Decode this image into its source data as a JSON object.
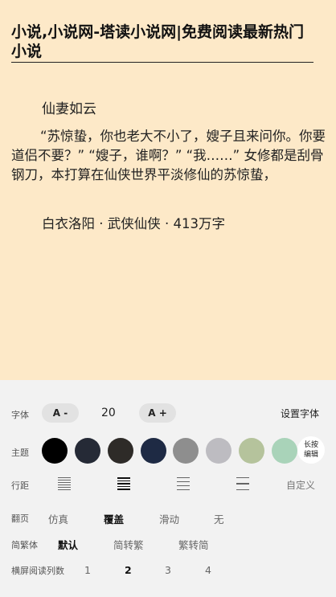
{
  "page": {
    "site_title": "小说,小说网-塔读小说网|免费阅读最新热门小说"
  },
  "book": {
    "title": "仙妻如云",
    "intro": "“苏惊蛰，你也老大不小了，嫂子且来问你。你要道侣不要？” “嫂子，谁啊？” “我……” 女修都是刮骨钢刀，本打算在仙侠世界平淡修仙的苏惊蛰，",
    "meta": "白衣洛阳 · 武侠仙侠 · 413万字"
  },
  "settings": {
    "font": {
      "label": "字体",
      "decrease": "A -",
      "size": "20",
      "increase": "A +",
      "set_font": "设置字体"
    },
    "theme": {
      "label": "主题",
      "colors": [
        "#000000",
        "#252a36",
        "#2e2b28",
        "#1e2a44",
        "#8e8e8e",
        "#bdbcc1",
        "#b5c39c",
        "#a9d3b9"
      ],
      "custom": "长按编辑"
    },
    "spacing": {
      "label": "行距",
      "options": [
        "spacing-tight-icon",
        "spacing-normal-icon",
        "spacing-loose-icon",
        "spacing-wide-icon"
      ],
      "selected": 1,
      "custom": "自定义"
    },
    "page_turn": {
      "label": "翻页",
      "options": [
        "仿真",
        "覆盖",
        "滑动",
        "无"
      ],
      "selected": 1
    },
    "script": {
      "label": "简繁体",
      "options": [
        "默认",
        "简转繁",
        "繁转简"
      ],
      "selected": 0
    },
    "columns": {
      "label": "横屏阅读列数",
      "options": [
        "1",
        "2",
        "3",
        "4"
      ],
      "selected": 1
    }
  }
}
